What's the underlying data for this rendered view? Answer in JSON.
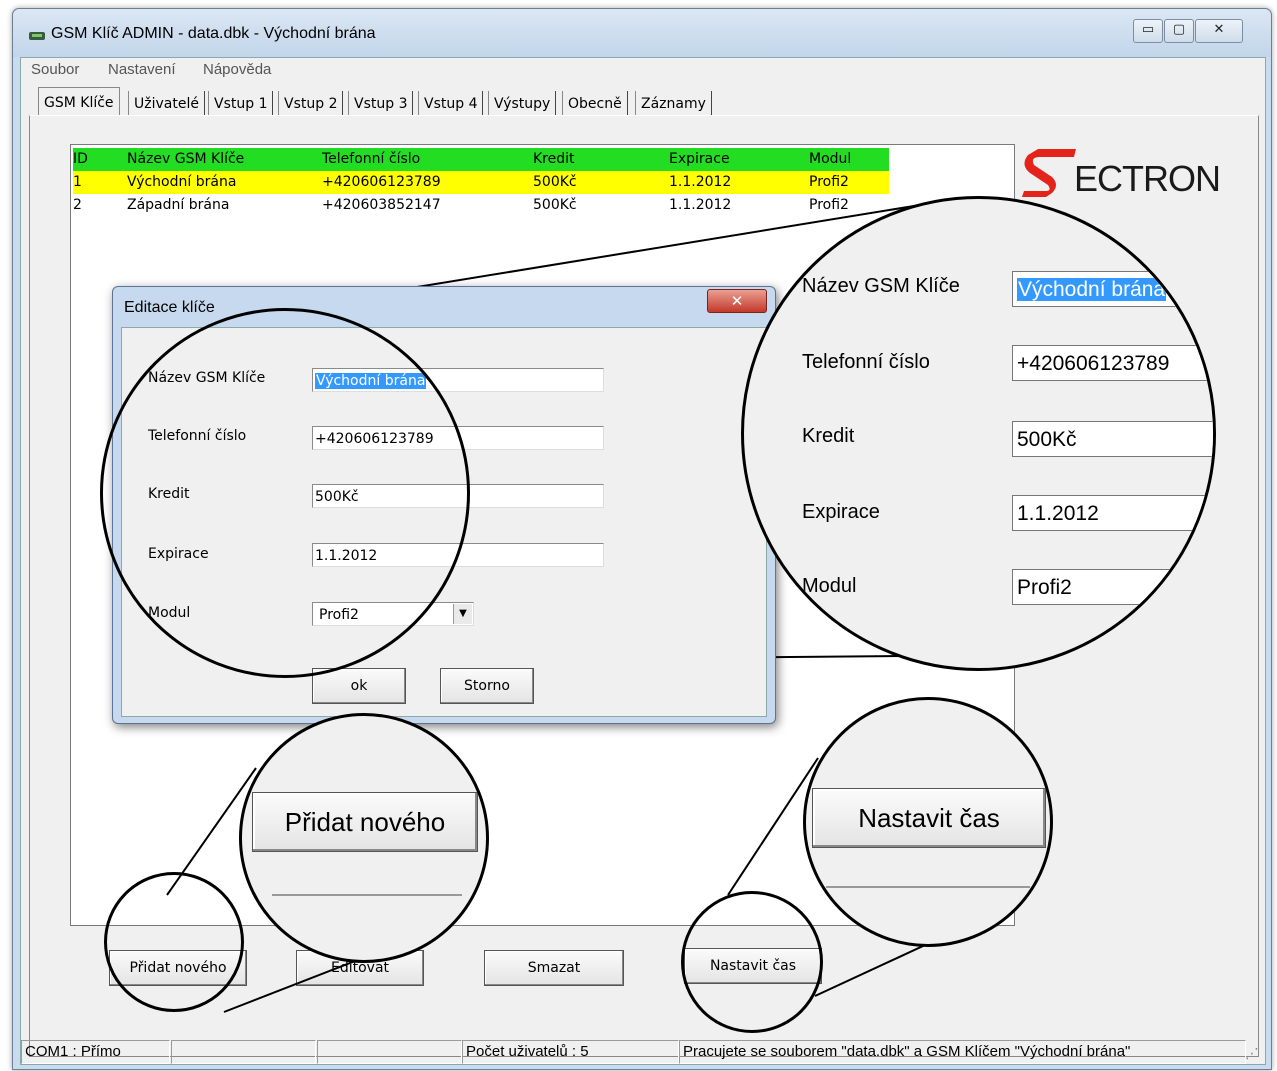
{
  "window": {
    "title": "GSM Klíč ADMIN - data.dbk - Východní brána",
    "controls": {
      "minimize": "▭",
      "maximize": "▢",
      "close": "✕"
    }
  },
  "menu": [
    {
      "label": "Soubor"
    },
    {
      "label": "Nastavení"
    },
    {
      "label": "Nápověda"
    }
  ],
  "tabs": [
    "GSM Klíče",
    "Uživatelé",
    "Vstup 1",
    "Vstup 2",
    "Vstup 3",
    "Vstup 4",
    "Výstupy",
    "Obecně",
    "Záznamy"
  ],
  "table": {
    "columns": [
      "ID",
      "Název GSM Klíče",
      "Telefonní číslo",
      "Kredit",
      "Expirace",
      "Modul"
    ],
    "rows": [
      [
        "1",
        "Východní brána",
        "+420606123789",
        "500Kč",
        "1.1.2012",
        "Profi2"
      ],
      [
        "2",
        "Západní brána",
        "+420603852147",
        "500Kč",
        "1.1.2012",
        "Profi2"
      ]
    ],
    "header_color": "#22dd22",
    "selected_color": "#ffff00"
  },
  "logo": {
    "text": "ECTRON",
    "accent": "#e3241b"
  },
  "buttons": {
    "add": "Přidat nového",
    "edit": "Editovat",
    "delete": "Smazat",
    "set_time": "Nastavit čas"
  },
  "statusbar": [
    "COM1 : Přímo",
    "",
    "",
    "Počet uživatelů : 5",
    "Pracujete se souborem \"data.dbk\" a GSM Klíčem \"Východní brána\""
  ],
  "dialog": {
    "title": "Editace klíče",
    "close": "✕",
    "fields": {
      "name_label": "Název GSM Klíče",
      "name_value": "Východní brána",
      "phone_label": "Telefonní číslo",
      "phone_value": "+420606123789",
      "credit_label": "Kredit",
      "credit_value": "500Kč",
      "expiry_label": "Expirace",
      "expiry_value": "1.1.2012",
      "module_label": "Modul",
      "module_value": "Profi2"
    },
    "ok": "ok",
    "cancel": "Storno"
  }
}
